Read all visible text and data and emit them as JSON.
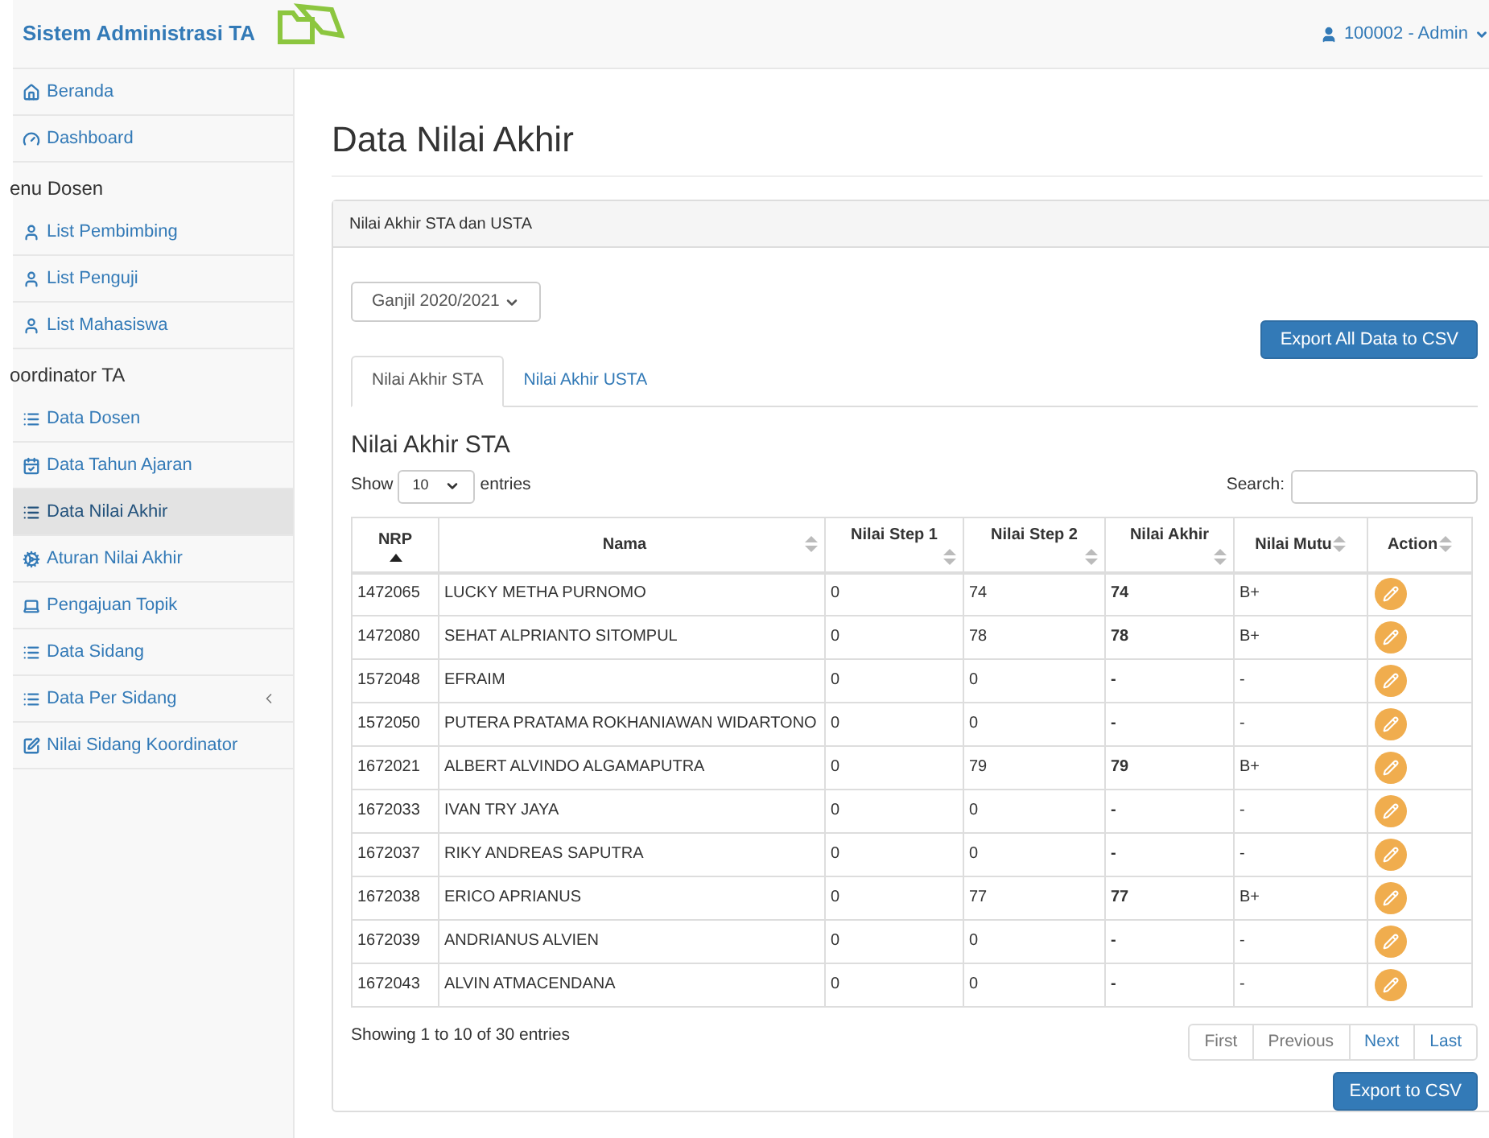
{
  "header": {
    "brand": "Sistem Administrasi TA",
    "user": "100002 - Admin"
  },
  "sidebar": {
    "items": [
      {
        "kind": "link",
        "label": "Beranda",
        "selected": false,
        "has_submenu": false
      },
      {
        "kind": "link",
        "label": "Dashboard",
        "selected": false,
        "has_submenu": false
      },
      {
        "kind": "heading",
        "label": "enu Dosen"
      },
      {
        "kind": "link",
        "label": "List Pembimbing",
        "selected": false,
        "has_submenu": false
      },
      {
        "kind": "link",
        "label": "List Penguji",
        "selected": false,
        "has_submenu": false
      },
      {
        "kind": "link",
        "label": "List Mahasiswa",
        "selected": false,
        "has_submenu": false
      },
      {
        "kind": "heading",
        "label": "oordinator TA"
      },
      {
        "kind": "link",
        "label": "Data Dosen",
        "selected": false,
        "has_submenu": false
      },
      {
        "kind": "link",
        "label": "Data Tahun Ajaran",
        "selected": false,
        "has_submenu": false
      },
      {
        "kind": "link",
        "label": "Data Nilai Akhir",
        "selected": true,
        "has_submenu": false
      },
      {
        "kind": "link",
        "label": "Aturan Nilai Akhir",
        "selected": false,
        "has_submenu": false
      },
      {
        "kind": "link",
        "label": "Pengajuan Topik",
        "selected": false,
        "has_submenu": false
      },
      {
        "kind": "link",
        "label": "Data Sidang",
        "selected": false,
        "has_submenu": false
      },
      {
        "kind": "link",
        "label": "Data Per Sidang",
        "selected": false,
        "has_submenu": true
      },
      {
        "kind": "link",
        "label": "Nilai Sidang Koordinator",
        "selected": false,
        "has_submenu": false
      }
    ]
  },
  "page_title": "Data Nilai Akhir",
  "panel": {
    "heading": "Nilai Akhir STA dan USTA",
    "semester": "Ganjil 2020/2021",
    "export_all": "Export All Data to CSV",
    "tabs": [
      {
        "label": "Nilai Akhir STA",
        "selected": true
      },
      {
        "label": "Nilai Akhir USTA",
        "selected": false
      }
    ],
    "section_title": "Nilai Akhir STA",
    "show_label": "Show",
    "page_size": "10",
    "entries_label": "entries",
    "search_label": "Search:",
    "table": {
      "columns": [
        {
          "label": "NRP",
          "sorted": true
        },
        {
          "label": "Nama",
          "sorted": false
        },
        {
          "label": "Nilai Step 1",
          "sorted": false
        },
        {
          "label": "Nilai Step 2",
          "sorted": false
        },
        {
          "label": "Nilai Akhir",
          "sorted": false
        },
        {
          "label": "Nilai Mutu",
          "sorted": false
        },
        {
          "label": "Action",
          "sorted": false
        }
      ],
      "rows": [
        {
          "nrp": "1472065",
          "nama": "LUCKY METHA PURNOMO",
          "step1": "0",
          "step2": "74",
          "akhir": "74",
          "mutu": "B+"
        },
        {
          "nrp": "1472080",
          "nama": "SEHAT ALPRIANTO SITOMPUL",
          "step1": "0",
          "step2": "78",
          "akhir": "78",
          "mutu": "B+"
        },
        {
          "nrp": "1572048",
          "nama": "EFRAIM",
          "step1": "0",
          "step2": "0",
          "akhir": "-",
          "mutu": "-"
        },
        {
          "nrp": "1572050",
          "nama": "PUTERA PRATAMA ROKHANIAWAN WIDARTONO",
          "step1": "0",
          "step2": "0",
          "akhir": "-",
          "mutu": "-"
        },
        {
          "nrp": "1672021",
          "nama": "ALBERT ALVINDO ALGAMAPUTRA",
          "step1": "0",
          "step2": "79",
          "akhir": "79",
          "mutu": "B+"
        },
        {
          "nrp": "1672033",
          "nama": "IVAN TRY JAYA",
          "step1": "0",
          "step2": "0",
          "akhir": "-",
          "mutu": "-"
        },
        {
          "nrp": "1672037",
          "nama": "RIKY ANDREAS SAPUTRA",
          "step1": "0",
          "step2": "0",
          "akhir": "-",
          "mutu": "-"
        },
        {
          "nrp": "1672038",
          "nama": "ERICO APRIANUS",
          "step1": "0",
          "step2": "77",
          "akhir": "77",
          "mutu": "B+"
        },
        {
          "nrp": "1672039",
          "nama": "ANDRIANUS ALVIEN",
          "step1": "0",
          "step2": "0",
          "akhir": "-",
          "mutu": "-"
        },
        {
          "nrp": "1672043",
          "nama": "ALVIN ATMACENDANA",
          "step1": "0",
          "step2": "0",
          "akhir": "-",
          "mutu": "-"
        }
      ]
    },
    "info": "Showing 1 to 10 of 30 entries",
    "pagination": [
      {
        "label": "First",
        "disabled": true
      },
      {
        "label": "Previous",
        "disabled": true
      },
      {
        "label": "Next",
        "disabled": false
      },
      {
        "label": "Last",
        "disabled": false
      }
    ],
    "export": "Export to CSV"
  }
}
